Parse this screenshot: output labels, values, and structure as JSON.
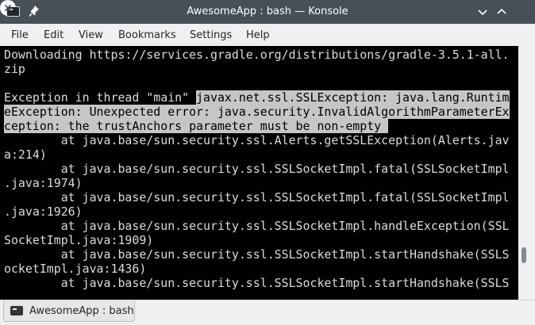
{
  "window": {
    "title": "AwesomeApp : bash — Konsole"
  },
  "menubar": {
    "items": [
      "File",
      "Edit",
      "View",
      "Bookmarks",
      "Settings",
      "Help"
    ]
  },
  "terminal": {
    "lines": [
      {
        "parts": [
          {
            "text": "Downloading https://services.gradle.org/distributions/gradle-3.5.1-all.",
            "hl": false
          }
        ]
      },
      {
        "parts": [
          {
            "text": "zip",
            "hl": false
          }
        ]
      },
      {
        "parts": [
          {
            "text": "",
            "hl": false
          }
        ]
      },
      {
        "parts": [
          {
            "text": "Exception in thread \"main\" ",
            "hl": false
          },
          {
            "text": "javax.net.ssl.SSLException: java.lang.Runtim",
            "hl": true
          }
        ]
      },
      {
        "parts": [
          {
            "text": "eException: Unexpected error: java.security.InvalidAlgorithmParameterEx",
            "hl": true
          }
        ]
      },
      {
        "parts": [
          {
            "text": "ception: the trustAnchors parameter must be non-empty ",
            "hl": true
          }
        ]
      },
      {
        "parts": [
          {
            "text": "        at java.base/sun.security.ssl.Alerts.getSSLException(Alerts.jav",
            "hl": false
          }
        ]
      },
      {
        "parts": [
          {
            "text": "a:214)",
            "hl": false
          }
        ]
      },
      {
        "parts": [
          {
            "text": "        at java.base/sun.security.ssl.SSLSocketImpl.fatal(SSLSocketImpl",
            "hl": false
          }
        ]
      },
      {
        "parts": [
          {
            "text": ".java:1974)",
            "hl": false
          }
        ]
      },
      {
        "parts": [
          {
            "text": "        at java.base/sun.security.ssl.SSLSocketImpl.fatal(SSLSocketImpl",
            "hl": false
          }
        ]
      },
      {
        "parts": [
          {
            "text": ".java:1926)",
            "hl": false
          }
        ]
      },
      {
        "parts": [
          {
            "text": "        at java.base/sun.security.ssl.SSLSocketImpl.handleException(SSL",
            "hl": false
          }
        ]
      },
      {
        "parts": [
          {
            "text": "SocketImpl.java:1909)",
            "hl": false
          }
        ]
      },
      {
        "parts": [
          {
            "text": "        at java.base/sun.security.ssl.SSLSocketImpl.startHandshake(SSLS",
            "hl": false
          }
        ]
      },
      {
        "parts": [
          {
            "text": "ocketImpl.java:1436)",
            "hl": false
          }
        ]
      },
      {
        "parts": [
          {
            "text": "        at java.base/sun.security.ssl.SSLSocketImpl.startHandshake(SSLS",
            "hl": false
          }
        ]
      }
    ]
  },
  "tabs": [
    {
      "label": "AwesomeApp : bash"
    }
  ],
  "icons": {
    "app": "terminal-icon",
    "pin": "pin-icon",
    "minimize": "chevron-down-icon",
    "maximize": "chevron-up-icon",
    "close": "close-icon"
  }
}
